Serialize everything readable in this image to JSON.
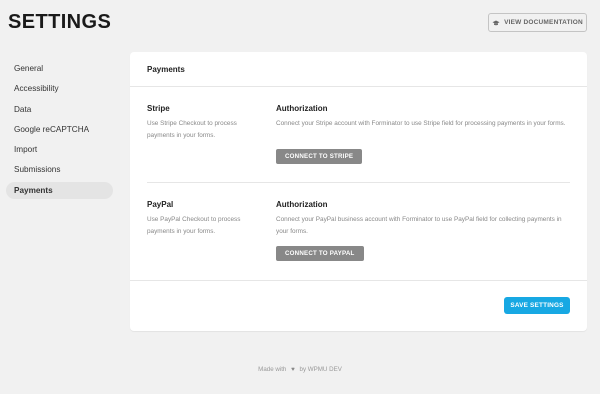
{
  "header": {
    "title": "SETTINGS",
    "doc_button": "VIEW DOCUMENTATION",
    "doc_icon": "academic-cap-icon"
  },
  "sidebar": {
    "items": [
      {
        "label": "General",
        "active": false
      },
      {
        "label": "Accessibility",
        "active": false
      },
      {
        "label": "Data",
        "active": false
      },
      {
        "label": "Google reCAPTCHA",
        "active": false
      },
      {
        "label": "Import",
        "active": false
      },
      {
        "label": "Submissions",
        "active": false
      },
      {
        "label": "Payments",
        "active": true
      }
    ]
  },
  "main": {
    "title": "Payments",
    "stripe": {
      "title": "Stripe",
      "description": "Use Stripe Checkout to process payments in your forms.",
      "auth_title": "Authorization",
      "auth_description": "Connect your Stripe account with Forminator to use Stripe field for processing payments in your forms.",
      "button": "CONNECT TO STRIPE"
    },
    "paypal": {
      "title": "PayPal",
      "description": "Use PayPal Checkout to process payments in your forms.",
      "auth_title": "Authorization",
      "auth_description": "Connect your PayPal business account with Forminator to use PayPal field for collecting payments in your forms.",
      "button": "CONNECT TO PAYPAL"
    },
    "save_button": "SAVE SETTINGS"
  },
  "footer": {
    "made_with": "Made with",
    "by": "by WPMU DEV"
  },
  "colors": {
    "primary": "#17a8e3",
    "button_gray": "#888888",
    "background": "#f1f1f1"
  }
}
